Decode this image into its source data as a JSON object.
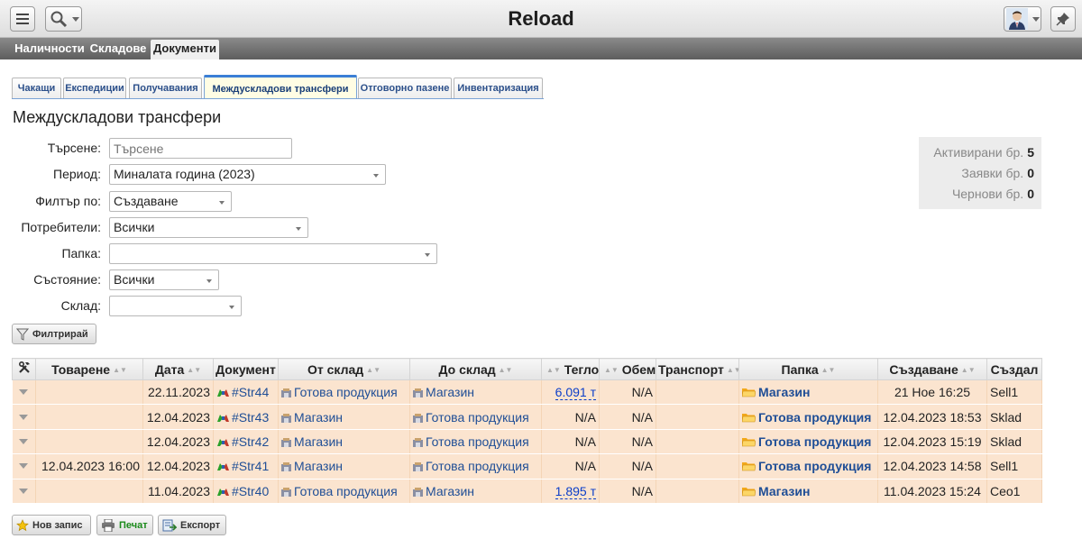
{
  "app": {
    "title": "Reload"
  },
  "main_nav": [
    {
      "label": "Наличности",
      "active": false
    },
    {
      "label": "Складове",
      "active": false
    },
    {
      "label": "Документи",
      "active": true
    }
  ],
  "sub_tabs": [
    {
      "label": "Чакащи",
      "active": false
    },
    {
      "label": "Експедиции",
      "active": false
    },
    {
      "label": "Получавания",
      "active": false
    },
    {
      "label": "Междускладови трансфери",
      "active": true
    },
    {
      "label": "Отговорно пазене",
      "active": false
    },
    {
      "label": "Инвентаризация",
      "active": false
    }
  ],
  "page_title": "Междускладови трансфери",
  "filters": {
    "search": {
      "label": "Търсене:",
      "placeholder": "Търсене",
      "value": ""
    },
    "period": {
      "label": "Период:",
      "value": "Миналата година (2023)"
    },
    "filter_by": {
      "label": "Филтър по:",
      "value": "Създаване"
    },
    "users": {
      "label": "Потребители:",
      "value": "Всички"
    },
    "folder": {
      "label": "Папка:",
      "value": ""
    },
    "state": {
      "label": "Състояние:",
      "value": "Всички"
    },
    "warehouse": {
      "label": "Склад:",
      "value": ""
    },
    "filter_button": "Филтрирай"
  },
  "stats": [
    {
      "label": "Активирани бр.",
      "value": "5"
    },
    {
      "label": "Заявки бр.",
      "value": "0"
    },
    {
      "label": "Чернови бр.",
      "value": "0"
    }
  ],
  "table": {
    "headers": {
      "loading": "Товарене",
      "date": "Дата",
      "document": "Документ",
      "from": "От склад",
      "to": "До склад",
      "weight": "Тегло",
      "volume": "Обем",
      "transport": "Транспорт",
      "folder": "Папка",
      "created": "Създаване",
      "author": "Създал"
    },
    "rows": [
      {
        "loading": "",
        "date": "22.11.2023",
        "doc": "#Str44",
        "from": "Готова продукция",
        "to": "Магазин",
        "weight": "6.091 т",
        "volume": "N/A",
        "transport": "",
        "folder": "Магазин",
        "created": "21 Ное 16:25",
        "author": "Sell1"
      },
      {
        "loading": "",
        "date": "12.04.2023",
        "doc": "#Str43",
        "from": "Магазин",
        "to": "Готова продукция",
        "weight": "N/A",
        "volume": "N/A",
        "transport": "",
        "folder": "Готова продукция",
        "created": "12.04.2023 18:53",
        "author": "Sklad"
      },
      {
        "loading": "",
        "date": "12.04.2023",
        "doc": "#Str42",
        "from": "Магазин",
        "to": "Готова продукция",
        "weight": "N/A",
        "volume": "N/A",
        "transport": "",
        "folder": "Готова продукция",
        "created": "12.04.2023 15:19",
        "author": "Sklad"
      },
      {
        "loading": "12.04.2023 16:00",
        "date": "12.04.2023",
        "doc": "#Str41",
        "from": "Магазин",
        "to": "Готова продукция",
        "weight": "N/A",
        "volume": "N/A",
        "transport": "",
        "folder": "Готова продукция",
        "created": "12.04.2023 14:58",
        "author": "Sell1"
      },
      {
        "loading": "",
        "date": "11.04.2023",
        "doc": "#Str40",
        "from": "Готова продукция",
        "to": "Магазин",
        "weight": "1.895 т",
        "volume": "N/A",
        "transport": "",
        "folder": "Магазин",
        "created": "11.04.2023 15:24",
        "author": "Ceo1"
      }
    ]
  },
  "bottom_buttons": {
    "new": "Нов запис",
    "print": "Печат",
    "export": "Експорт"
  },
  "icons": [
    "menu-icon",
    "search-icon",
    "avatar",
    "pin-icon",
    "filter-icon",
    "tools-icon",
    "warehouse-icon",
    "document-icon",
    "folder-icon",
    "star-icon",
    "printer-icon",
    "export-icon"
  ],
  "colors": {
    "row_background": "#fbe4cf",
    "active_tab": "#fffde4",
    "link": "#1f4e96",
    "user_sell1": "#a0781e",
    "user_sklad": "#b21fb5",
    "user_ceo1": "#1b2fd9"
  }
}
